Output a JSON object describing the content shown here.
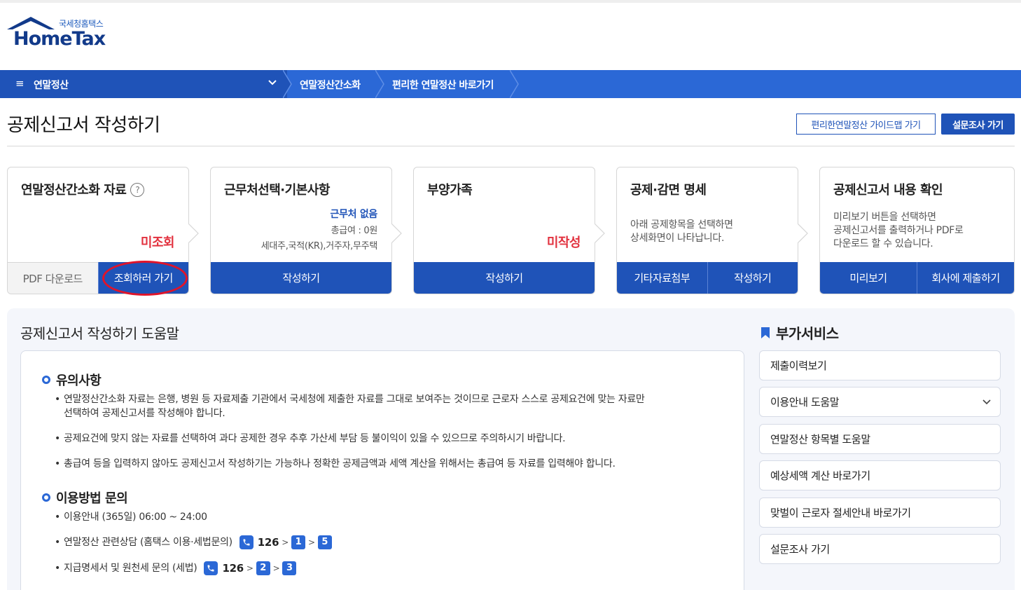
{
  "logo": {
    "sub": "국세청홈택스",
    "main": "HomeTax"
  },
  "nav": {
    "menu_label": "연말정산",
    "hamburger": "≡",
    "crumbs": [
      "연말정산간소화",
      "편리한 연말정산 바로가기"
    ]
  },
  "page": {
    "title": "공제신고서 작성하기",
    "guide_button": "편리한연말정산 가이드맵 가기",
    "survey_button": "설문조사 가기"
  },
  "cards": [
    {
      "title": "연말정산간소화 자료",
      "help": "?",
      "status": "미조회",
      "buttons": [
        "PDF 다운로드",
        "조회하러 가기"
      ]
    },
    {
      "title": "근무처선택·기본사항",
      "workplace": "근무처 없음",
      "salary": "총급여 : 0원",
      "household": "세대주,국적(KR),거주자,무주택",
      "buttons": [
        "작성하기"
      ]
    },
    {
      "title": "부양가족",
      "status": "미작성",
      "buttons": [
        "작성하기"
      ]
    },
    {
      "title": "공제·감면 명세",
      "desc": [
        "아래 공제항목을 선택하면",
        "상세화면이 나타납니다."
      ],
      "buttons": [
        "기타자료첨부",
        "작성하기"
      ]
    },
    {
      "title": "공제신고서 내용 확인",
      "desc": [
        "미리보기 버튼을 선택하면",
        "공제신고서를 출력하거나 PDF로",
        "다운로드 할 수 있습니다."
      ],
      "buttons": [
        "미리보기",
        "회사에 제출하기"
      ]
    }
  ],
  "help": {
    "title": "공제신고서 작성하기 도움말",
    "notice_title": "유의사항",
    "notice_items": [
      [
        "연말정산간소화 자료는 은행, 병원 등 자료제출 기관에서 국세청에 제출한 자료를 그대로 보여주는 것이므로 근로자 스스로 공제요건에 맞는 자료만",
        "선택하여 공제신고서를 작성해야 합니다."
      ],
      [
        "공제요건에 맞지 않는 자료를 선택하여 과다 공제한 경우 추후 가산세 부담 등 불이익이 있을 수 있으므로 주의하시기 바랍니다."
      ],
      [
        "총급여 등을 입력하지 않아도 공제신고서 작성하기는 가능하나 정확한 공제금액과 세액 계산을 위해서는 총급여 등 자료를 입력해야 합니다."
      ]
    ],
    "contact_title": "이용방법 문의",
    "hours": "이용안내 (365일) 06:00 ~ 24:00",
    "phone_rows": [
      {
        "label": "연말정산 관련상담 (홈택스 이용·세법문의)",
        "number": "126",
        "steps": [
          "1",
          "5"
        ]
      },
      {
        "label": "지급명세서 및 원천세 문의 (세법)",
        "number": "126",
        "steps": [
          "2",
          "3"
        ]
      }
    ],
    "gt": ">"
  },
  "services": {
    "title": "부가서비스",
    "items": [
      "제출이력보기",
      "이용안내 도움말",
      "연말정산 항목별 도움말",
      "예상세액 계산 바로가기",
      "맞벌이 근로자 절세안내 바로가기",
      "설문조사 가기"
    ]
  },
  "colors": {
    "primary": "#1f53b8",
    "nav": "#2b68d6",
    "alert": "#e2323f",
    "highlight_oval": "#e0142a"
  }
}
